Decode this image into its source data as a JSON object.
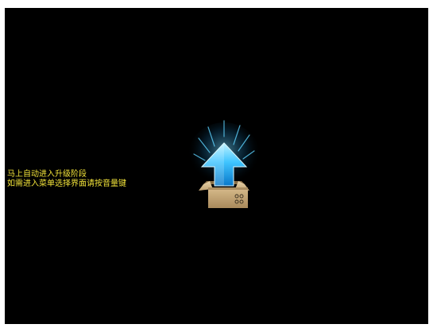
{
  "screen": {
    "background": "#000000",
    "message": {
      "line1": "马上自动进入升级阶段",
      "line2": "如需进入菜单选择界面请按音量键",
      "color": "#f2e33a"
    },
    "graphic": {
      "icon": "upgrade-box-icon",
      "arrow_color": "#3fc4ff",
      "box_color": "#c7a878"
    }
  }
}
